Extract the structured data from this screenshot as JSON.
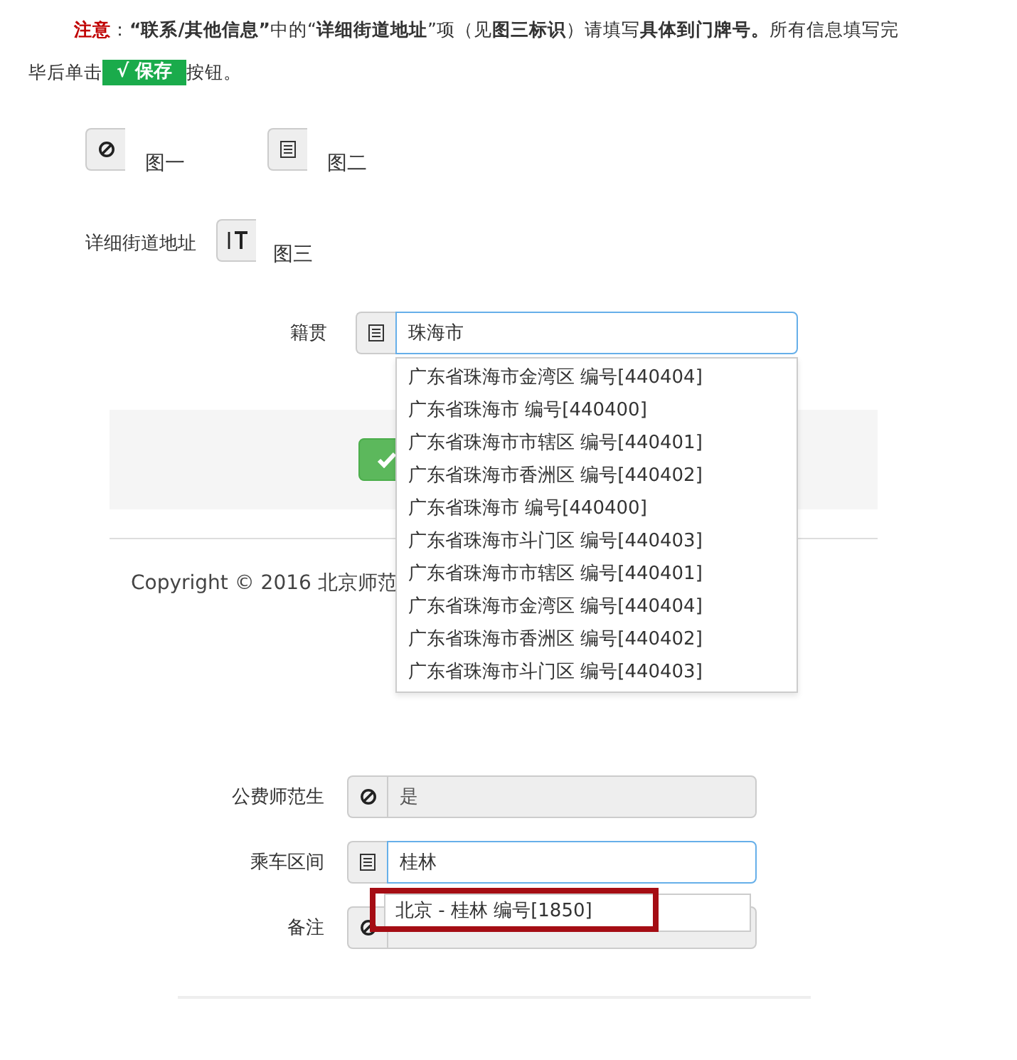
{
  "notice": {
    "segments": [
      {
        "kind": "alert",
        "text": "注意"
      },
      {
        "kind": "plain",
        "text": "："
      },
      {
        "kind": "bold",
        "text": "“联系/其他信息”"
      },
      {
        "kind": "plain",
        "text": "中的“"
      },
      {
        "kind": "bold",
        "text": "详细街道地址"
      },
      {
        "kind": "plain",
        "text": "”项（见"
      },
      {
        "kind": "bold",
        "text": "图三标识"
      },
      {
        "kind": "plain",
        "text": "）请填写"
      },
      {
        "kind": "bold",
        "text": "具体到门牌号。"
      },
      {
        "kind": "plain",
        "text": "所有信息填写完"
      }
    ],
    "lead": "毕后单击",
    "save_badge": "√ 保存",
    "tail": "按钮。"
  },
  "figures": [
    {
      "kind": "ban",
      "caption": "图一"
    },
    {
      "kind": "list",
      "caption": "图二"
    },
    {
      "kind": "text",
      "label": "详细街道地址",
      "caption": "图三"
    }
  ],
  "screenshot_1": {
    "label": "籍贯",
    "value": "珠海市",
    "copyright": "Copyright © 2016 北京师范",
    "suggestions": [
      "广东省珠海市金湾区 编号[440404]",
      "广东省珠海市 编号[440400]",
      "广东省珠海市市辖区 编号[440401]",
      "广东省珠海市香洲区 编号[440402]",
      "广东省珠海市 编号[440400]",
      "广东省珠海市斗门区 编号[440403]",
      "广东省珠海市市辖区 编号[440401]",
      "广东省珠海市金湾区 编号[440404]",
      "广东省珠海市香洲区 编号[440402]",
      "广东省珠海市斗门区 编号[440403]"
    ]
  },
  "screenshot_2": {
    "fields": [
      {
        "label": "公费师范生",
        "kind": "ban",
        "value": "是",
        "readonly": true
      },
      {
        "label": "乘车区间",
        "kind": "list",
        "value": "桂林",
        "readonly": false
      },
      {
        "label": "备注",
        "kind": "ban",
        "readonly": true
      }
    ],
    "suggestion": "北京 - 桂林 编号[1850]",
    "suggestion_highlighted": true
  }
}
